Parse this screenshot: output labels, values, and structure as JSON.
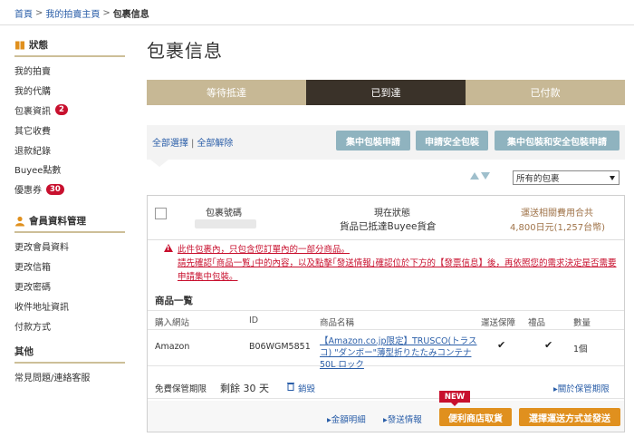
{
  "breadcrumb": {
    "home": "首頁",
    "my_page": "我的拍賣主頁",
    "current": "包裹信息"
  },
  "sidebar": {
    "status": {
      "title": "狀態",
      "items": [
        {
          "label": "我的拍賣"
        },
        {
          "label": "我的代購"
        },
        {
          "label": "包裹資訊",
          "badge": "2"
        },
        {
          "label": "其它收費"
        },
        {
          "label": "退款紀錄"
        },
        {
          "label": "Buyee點數"
        },
        {
          "label": "優惠券",
          "badge": "30"
        }
      ]
    },
    "member": {
      "title": "會員資料管理",
      "items": [
        {
          "label": "更改會員資料"
        },
        {
          "label": "更改信箱"
        },
        {
          "label": "更改密碼"
        },
        {
          "label": "收件地址資訊"
        },
        {
          "label": "付款方式"
        }
      ]
    },
    "other": {
      "title": "其他",
      "items": [
        {
          "label": "常見問題/連絡客服"
        }
      ]
    }
  },
  "main": {
    "title": "包裹信息",
    "tabs": [
      {
        "label": "等待抵達",
        "active": false
      },
      {
        "label": "已到達",
        "active": true
      },
      {
        "label": "已付款",
        "active": false
      }
    ],
    "select_all": "全部選擇",
    "deselect_all": "全部解除",
    "buttons": {
      "consolidate": "集中包裝申請",
      "safe_pack": "申請安全包裝",
      "both": "集中包裝和安全包裝申請"
    },
    "filter": {
      "selected": "所有的包裹"
    }
  },
  "package": {
    "number_label": "包裹號碼",
    "status_label": "現在狀態",
    "status_value": "貨品已抵達Buyee貨倉",
    "fee_label": "運送相關費用合共",
    "fee_value": "4,800日元(1,257台幣)",
    "warning_line1": "此件包裹內，只包含您訂單內的一部分商品。",
    "warning_line2": "請先確認｢商品一覧｣中的內容，以及點擊｢發送情報｣確認位於下方的【發票信息】後，再依照您的需求決定是否需要申請集中包裝。",
    "list_title": "商品一覧",
    "columns": {
      "site": "購入網站",
      "id": "ID",
      "name": "商品名稱",
      "insurance": "運送保障",
      "gift": "禮品",
      "qty": "數量"
    },
    "items": [
      {
        "site": "Amazon",
        "id": "B06WGM5851",
        "name": "【Amazon.co.jp限定】TRUSCO(トラスコ) \"ダンボー\"薄型折りたたみコンテナ 50L ロック",
        "insurance": "✔",
        "gift": "✔",
        "qty": "1個"
      }
    ],
    "storage_label": "免費保管期限",
    "storage_remaining": "剩餘 30 天",
    "cancel": "銷毀",
    "storage_link": "關於保管期限",
    "fee_detail": "金額明細",
    "ship_info": "發送情報",
    "new_tag": "NEW",
    "convenience_btn": "便利商店取貨",
    "shipping_btn": "選擇運送方式並發送"
  },
  "colors": {
    "tab_inactive": "#c7b895",
    "tab_active": "#3a3229",
    "action_button": "#8fb3bf",
    "orange_button": "#e0901e",
    "warning": "#c8102e",
    "fee": "#a0744a"
  }
}
